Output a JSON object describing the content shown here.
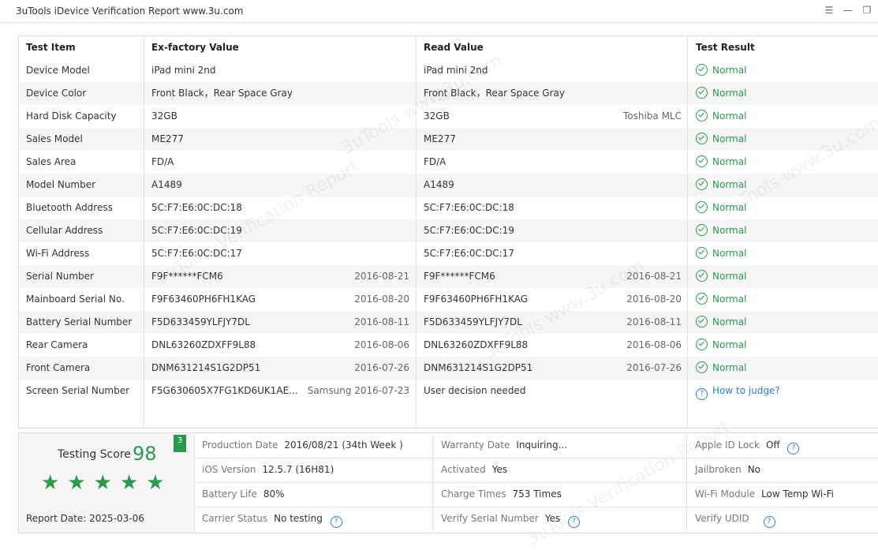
{
  "window": {
    "title": "3uTools iDevice Verification Report www.3u.com"
  },
  "icons": [
    "list-icon",
    "minimize-icon",
    "restore-icon",
    "check-circle-icon",
    "question-circle-icon",
    "star-icon"
  ],
  "colors": {
    "accent": "#2a9a4d",
    "link": "#2b7fd4"
  },
  "table": {
    "headers": [
      "Test Item",
      "Ex-factory Value",
      "Read Value",
      "Test Result"
    ],
    "rows": [
      {
        "item": "Device Model",
        "ex": "iPad mini 2nd",
        "ex_extra": "",
        "read": "iPad mini 2nd",
        "read_extra": "",
        "result": "Normal",
        "status": "ok"
      },
      {
        "item": "Device Color",
        "ex": "Front Black，Rear Space Gray",
        "ex_extra": "",
        "read": "Front Black，Rear Space Gray",
        "read_extra": "",
        "result": "Normal",
        "status": "ok"
      },
      {
        "item": "Hard Disk Capacity",
        "ex": "32GB",
        "ex_extra": "",
        "read": "32GB",
        "read_extra": "Toshiba MLC",
        "result": "Normal",
        "status": "ok"
      },
      {
        "item": "Sales Model",
        "ex": "ME277",
        "ex_extra": "",
        "read": "ME277",
        "read_extra": "",
        "result": "Normal",
        "status": "ok"
      },
      {
        "item": "Sales Area",
        "ex": "FD/A",
        "ex_extra": "",
        "read": "FD/A",
        "read_extra": "",
        "result": "Normal",
        "status": "ok"
      },
      {
        "item": "Model Number",
        "ex": "A1489",
        "ex_extra": "",
        "read": "A1489",
        "read_extra": "",
        "result": "Normal",
        "status": "ok"
      },
      {
        "item": "Bluetooth Address",
        "ex": "5C:F7:E6:0C:DC:18",
        "ex_extra": "",
        "read": "5C:F7:E6:0C:DC:18",
        "read_extra": "",
        "result": "Normal",
        "status": "ok"
      },
      {
        "item": "Cellular Address",
        "ex": "5C:F7:E6:0C:DC:19",
        "ex_extra": "",
        "read": "5C:F7:E6:0C:DC:19",
        "read_extra": "",
        "result": "Normal",
        "status": "ok"
      },
      {
        "item": "Wi-Fi Address",
        "ex": "5C:F7:E6:0C:DC:17",
        "ex_extra": "",
        "read": "5C:F7:E6:0C:DC:17",
        "read_extra": "",
        "result": "Normal",
        "status": "ok"
      },
      {
        "item": "Serial Number",
        "ex": "F9F******FCM6",
        "ex_extra": "2016-08-21",
        "read": "F9F******FCM6",
        "read_extra": "2016-08-21",
        "result": "Normal",
        "status": "ok"
      },
      {
        "item": "Mainboard Serial No.",
        "ex": "F9F63460PH6FH1KAG",
        "ex_extra": "2016-08-20",
        "read": "F9F63460PH6FH1KAG",
        "read_extra": "2016-08-20",
        "result": "Normal",
        "status": "ok"
      },
      {
        "item": "Battery Serial Number",
        "ex": "F5D633459YLFJY7DL",
        "ex_extra": "2016-08-11",
        "read": "F5D633459YLFJY7DL",
        "read_extra": "2016-08-11",
        "result": "Normal",
        "status": "ok"
      },
      {
        "item": "Rear Camera",
        "ex": "DNL63260ZDXFF9L88",
        "ex_extra": "2016-08-06",
        "read": "DNL63260ZDXFF9L88",
        "read_extra": "2016-08-06",
        "result": "Normal",
        "status": "ok"
      },
      {
        "item": "Front Camera",
        "ex": "DNM631214S1G2DP51",
        "ex_extra": "2016-07-26",
        "read": "DNM631214S1G2DP51",
        "read_extra": "2016-07-26",
        "result": "Normal",
        "status": "ok"
      },
      {
        "item": "Screen Serial Number",
        "ex": "F5G630605X7FG1KD6UK1AE...",
        "ex_extra": "Samsung 2016-07-23",
        "read": "User decision needed",
        "read_extra": "",
        "result": "How to judge?",
        "status": "help"
      }
    ]
  },
  "summary": {
    "score_label": "Testing Score",
    "score": "98",
    "badge": "3",
    "stars": 5,
    "report_date_label": "Report Date:",
    "report_date": "2025-03-06",
    "fields": [
      {
        "label": "Production Date",
        "value": "2016/08/21 (34th Week )"
      },
      {
        "label": "Warranty Date",
        "value": "Inquiring..."
      },
      {
        "label": "Apple ID Lock",
        "value": "Off"
      },
      {
        "label": "iOS Version",
        "value": "12.5.7 (16H81)"
      },
      {
        "label": "Activated",
        "value": "Yes"
      },
      {
        "label": "Jailbroken",
        "value": "No"
      },
      {
        "label": "Battery Life",
        "value": "80%"
      },
      {
        "label": "Charge Times",
        "value": "753 Times"
      },
      {
        "label": "Wi-Fi Module",
        "value": "Low Temp Wi-Fi"
      },
      {
        "label": "Carrier Status",
        "value": "No testing"
      },
      {
        "label": "Verify Serial Number",
        "value": "Yes"
      },
      {
        "label": "Verify UDID",
        "value": ""
      }
    ]
  }
}
